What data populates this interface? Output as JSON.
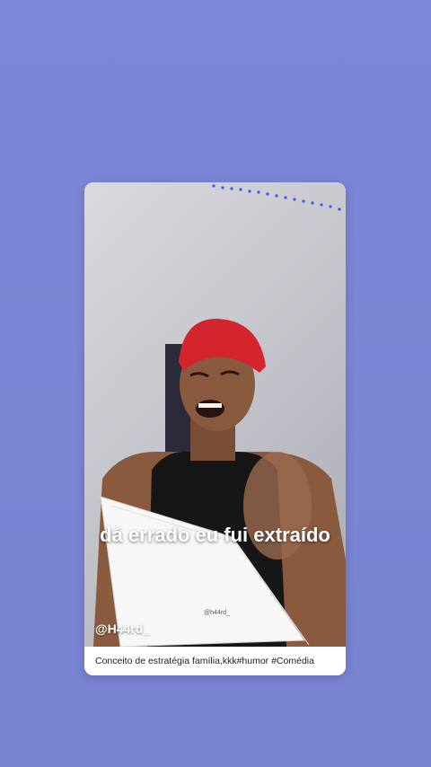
{
  "post": {
    "overlay_caption": "dá errado eu fui extraído",
    "handle": "@H44rd_",
    "paper_tag": "@h44rd_",
    "description": "Conceito de estratégia família,kkk#humor #Comédia"
  },
  "colors": {
    "background": "#7b86d6",
    "card": "#ffffff",
    "cap": "#d4252f",
    "led": "#3a4dff"
  }
}
